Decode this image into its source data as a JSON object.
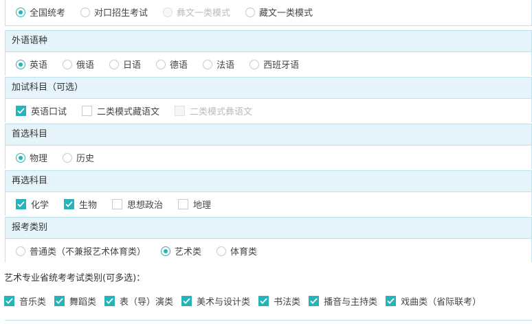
{
  "exam_mode": {
    "options": [
      {
        "label": "全国统考",
        "state": "checked"
      },
      {
        "label": "对口招生考试",
        "state": "unchecked"
      },
      {
        "label": "彝文一类模式",
        "state": "disabled"
      },
      {
        "label": "藏文一类模式",
        "state": "unchecked"
      }
    ]
  },
  "foreign_language": {
    "title": "外语语种",
    "options": [
      {
        "label": "英语",
        "state": "checked"
      },
      {
        "label": "俄语",
        "state": "unchecked"
      },
      {
        "label": "日语",
        "state": "unchecked"
      },
      {
        "label": "德语",
        "state": "unchecked"
      },
      {
        "label": "法语",
        "state": "unchecked"
      },
      {
        "label": "西班牙语",
        "state": "unchecked"
      }
    ]
  },
  "extra_subjects": {
    "title": "加试科目（可选）",
    "options": [
      {
        "label": "英语口试",
        "state": "checked"
      },
      {
        "label": "二类模式藏语文",
        "state": "unchecked"
      },
      {
        "label": "二类模式彝语文",
        "state": "disabled"
      }
    ]
  },
  "first_choice": {
    "title": "首选科目",
    "options": [
      {
        "label": "物理",
        "state": "checked"
      },
      {
        "label": "历史",
        "state": "unchecked"
      }
    ]
  },
  "second_choice": {
    "title": "再选科目",
    "options": [
      {
        "label": "化学",
        "state": "checked"
      },
      {
        "label": "生物",
        "state": "checked"
      },
      {
        "label": "思想政治",
        "state": "unchecked"
      },
      {
        "label": "地理",
        "state": "unchecked"
      }
    ]
  },
  "category": {
    "title": "报考类别",
    "options": [
      {
        "label": "普通类（不兼报艺术体育类）",
        "state": "unchecked"
      },
      {
        "label": "艺术类",
        "state": "checked"
      },
      {
        "label": "体育类",
        "state": "unchecked"
      }
    ]
  },
  "art_exam": {
    "title": "艺术专业省统考考试类别(可多选)：",
    "options": [
      {
        "label": "音乐类",
        "state": "checked"
      },
      {
        "label": "舞蹈类",
        "state": "checked"
      },
      {
        "label": "表（导）演类",
        "state": "checked"
      },
      {
        "label": "美术与设计类",
        "state": "checked"
      },
      {
        "label": "书法类",
        "state": "checked"
      },
      {
        "label": "播音与主持类",
        "state": "checked"
      },
      {
        "label": "戏曲类（省际联考）",
        "state": "checked"
      }
    ]
  },
  "colors": {
    "accent": "#27b3b8",
    "header_bg": "#e5f4fb",
    "border": "#bfe3ef"
  }
}
